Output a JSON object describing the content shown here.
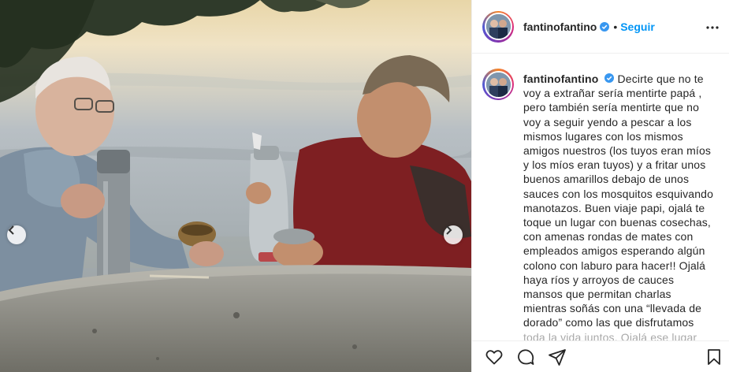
{
  "post": {
    "author": "fantinofantino",
    "verified": true,
    "follow_label": "Seguir",
    "separator": "•",
    "caption": "Decirte que no te voy a extrañar sería mentirte papá , pero también sería mentirte que no voy a seguir yendo a pescar a los mismos lugares con los mismos amigos nuestros (los tuyos eran míos y los míos eran tuyos) y a fritar unos buenos amarillos debajo de unos sauces con los mosquitos esquivando manotazos. Buen viaje papi, ojalá te toque un lugar con buenas cosechas, con amenas rondas de mates con empleados amigos esperando algún colono con laburo para hacer!! Ojalá haya ríos y arroyos de cauces mansos que permitan charlas mientras soñás con una “llevada de dorado” como las que disfrutamos toda la vida juntos. Ojalá ese lugar tenga gente para que"
  },
  "icons": {
    "verified": "verified-badge-icon",
    "more": "more-options-icon",
    "like": "heart-icon",
    "comment": "comment-icon",
    "share": "share-icon",
    "save": "bookmark-icon",
    "prev": "chevron-left-icon",
    "next": "chevron-right-icon"
  },
  "colors": {
    "accent": "#0095f6",
    "text": "#262626",
    "border": "#efefef",
    "verified": "#3897f0"
  }
}
